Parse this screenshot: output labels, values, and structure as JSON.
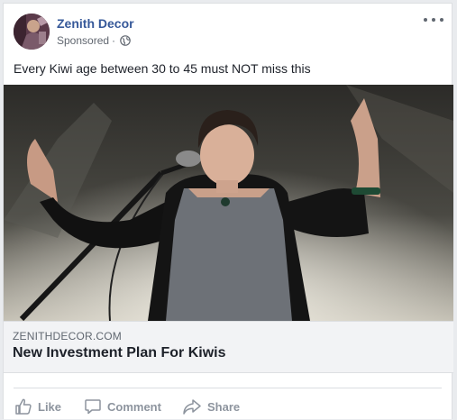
{
  "post": {
    "page_name": "Zenith Decor",
    "sponsored_label": "Sponsored",
    "separator": "·",
    "text": "Every Kiwi age between 30 to 45 must NOT miss this"
  },
  "link": {
    "domain": "ZENITHDECOR.COM",
    "title": "New Investment Plan For Kiwis"
  },
  "actions": {
    "like": "Like",
    "comment": "Comment",
    "share": "Share"
  },
  "colors": {
    "page_name": "#365899",
    "text": "#1d2129",
    "muted": "#8d949e",
    "link_box_bg": "#f2f3f5"
  },
  "icons": [
    "globe-icon",
    "more-options-icon",
    "like-icon",
    "comment-icon",
    "share-icon"
  ]
}
